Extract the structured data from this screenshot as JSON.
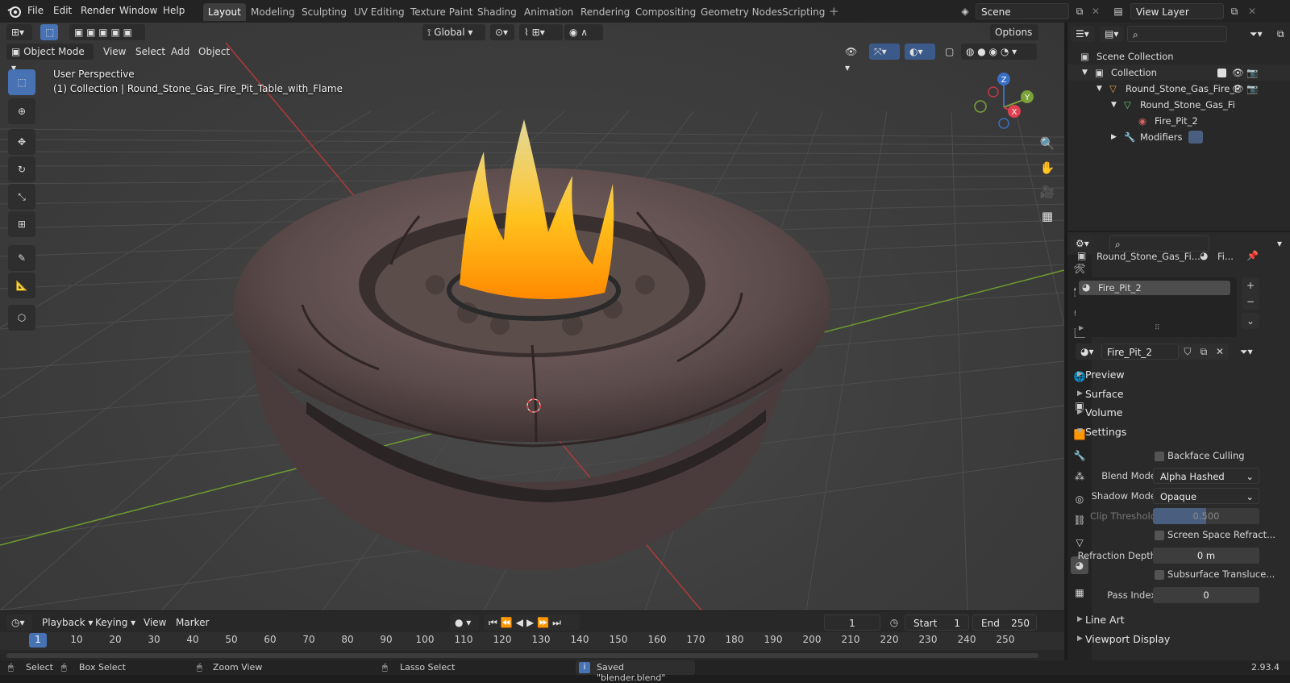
{
  "menu": [
    "File",
    "Edit",
    "Render",
    "Window",
    "Help"
  ],
  "workspaces": [
    "Layout",
    "Modeling",
    "Sculpting",
    "UV Editing",
    "Texture Paint",
    "Shading",
    "Animation",
    "Rendering",
    "Compositing",
    "Geometry Nodes",
    "Scripting"
  ],
  "active_workspace": "Layout",
  "scene_name": "Scene",
  "view_layer_name": "View Layer",
  "viewport": {
    "mode": "Object Mode",
    "menus": [
      "View",
      "Select",
      "Add",
      "Object"
    ],
    "transform_orientation": "Global",
    "options_label": "Options",
    "perspective_label": "User Perspective",
    "collection_label": "(1) Collection | Round_Stone_Gas_Fire_Pit_Table_with_Flame",
    "gizmo_axes": {
      "z": "Z",
      "y": "Y",
      "x": "X"
    }
  },
  "outliner": {
    "rows": [
      {
        "label": "Scene Collection",
        "icon": "scene-collection-icon"
      },
      {
        "label": "Collection",
        "icon": "collection-icon"
      },
      {
        "label": "Round_Stone_Gas_Fire_P",
        "icon": "object-icon"
      },
      {
        "label": "Round_Stone_Gas_Fi",
        "icon": "mesh-icon"
      },
      {
        "label": "Fire_Pit_2",
        "icon": "material-icon"
      },
      {
        "label": "Modifiers",
        "icon": "wrench-icon"
      }
    ]
  },
  "properties": {
    "object_name": "Round_Stone_Gas_Fi...",
    "material_short": "Fi...",
    "material_slot": "Fire_Pit_2",
    "material_name": "Fire_Pit_2",
    "panels": {
      "preview": "Preview",
      "surface": "Surface",
      "volume": "Volume",
      "settings": "Settings",
      "line_art": "Line Art",
      "viewport_display": "Viewport Display"
    },
    "settings": {
      "backface_culling": "Backface Culling",
      "blend_mode_label": "Blend Mode",
      "blend_mode_value": "Alpha Hashed",
      "shadow_mode_label": "Shadow Mode",
      "shadow_mode_value": "Opaque",
      "clip_threshold_label": "Clip Threshold",
      "clip_threshold_value": "0.500",
      "screen_space_refraction": "Screen Space Refract...",
      "refraction_depth_label": "Refraction Depth",
      "refraction_depth_value": "0 m",
      "subsurface_translucency": "Subsurface Transluce...",
      "pass_index_label": "Pass Index",
      "pass_index_value": "0"
    }
  },
  "timeline": {
    "menus": [
      "Playback",
      "Keying",
      "View",
      "Marker"
    ],
    "current_frame": "1",
    "start_label": "Start",
    "start_value": "1",
    "end_label": "End",
    "end_value": "250",
    "ticks": [
      "1",
      "10",
      "20",
      "30",
      "40",
      "50",
      "60",
      "70",
      "80",
      "90",
      "100",
      "110",
      "120",
      "130",
      "140",
      "150",
      "160",
      "170",
      "180",
      "190",
      "200",
      "210",
      "220",
      "230",
      "240",
      "250"
    ]
  },
  "statusbar": {
    "select": "Select",
    "box_select": "Box Select",
    "zoom_view": "Zoom View",
    "lasso_select": "Lasso Select",
    "message": "Saved \"blender.blend\"",
    "version": "2.93.4"
  }
}
